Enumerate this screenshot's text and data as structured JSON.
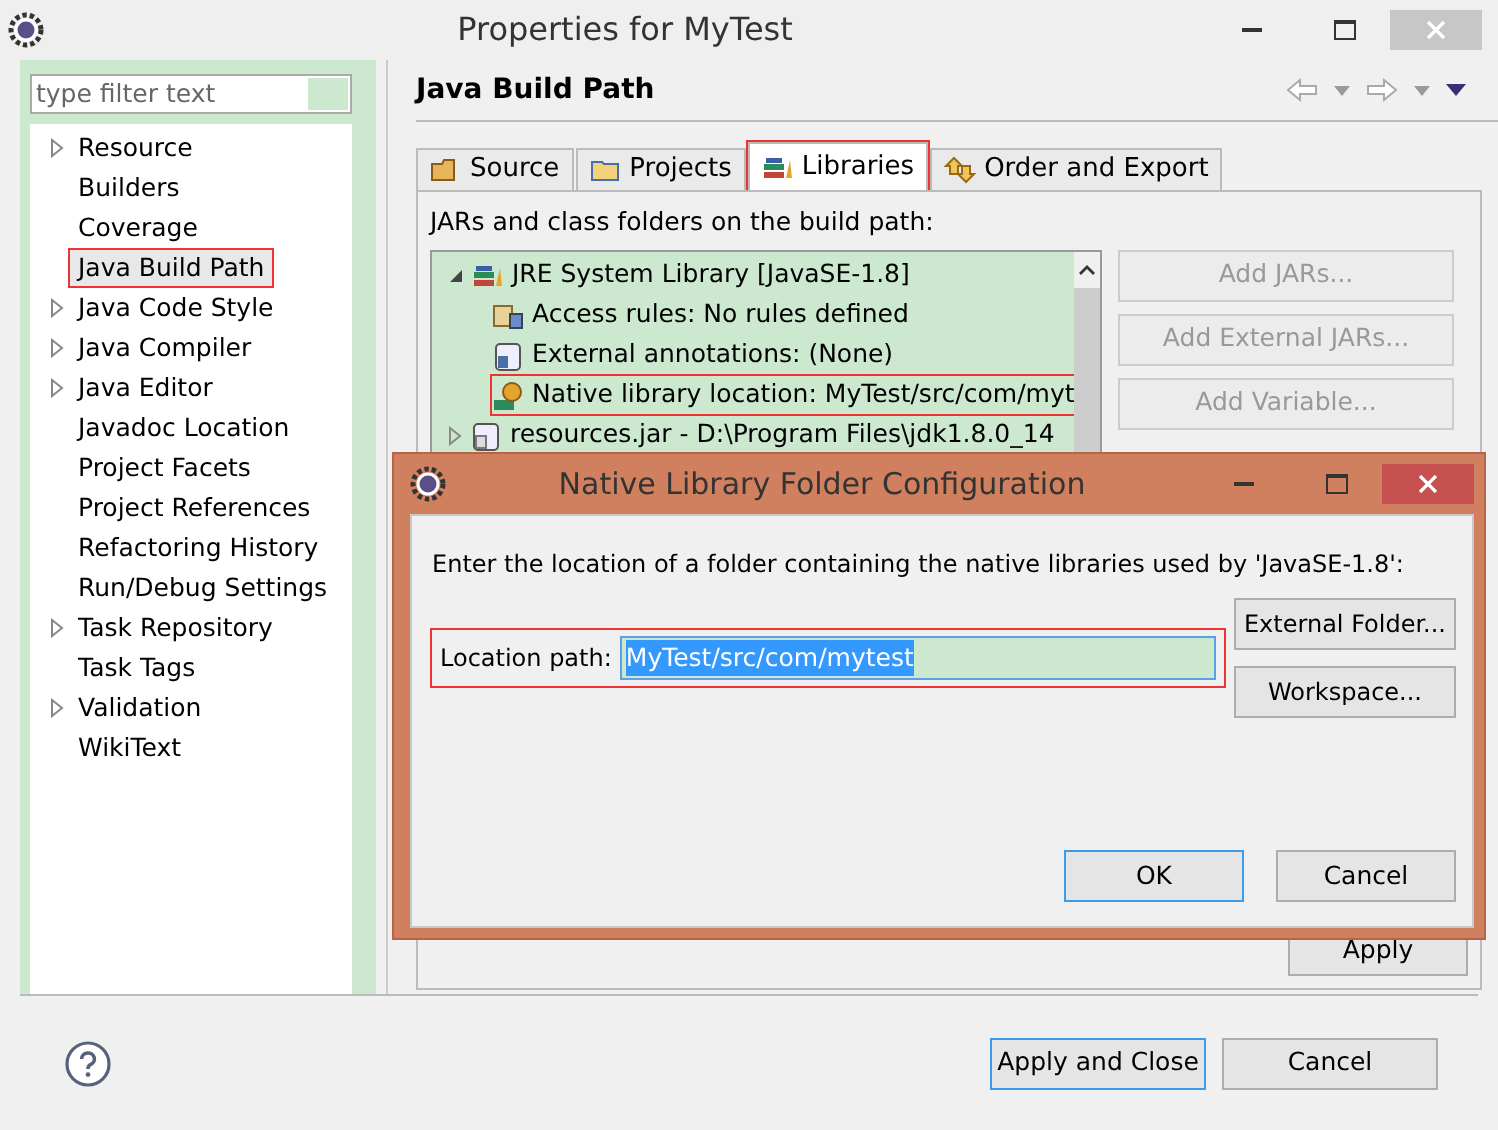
{
  "window": {
    "title": "Properties for MyTest"
  },
  "filter": {
    "placeholder": "type filter text"
  },
  "sidebar": {
    "items": [
      {
        "label": "Resource",
        "expandable": true,
        "selected": false,
        "annotated": false
      },
      {
        "label": "Builders",
        "expandable": false,
        "selected": false,
        "annotated": false
      },
      {
        "label": "Coverage",
        "expandable": false,
        "selected": false,
        "annotated": false
      },
      {
        "label": "Java Build Path",
        "expandable": false,
        "selected": true,
        "annotated": true
      },
      {
        "label": "Java Code Style",
        "expandable": true,
        "selected": false,
        "annotated": false
      },
      {
        "label": "Java Compiler",
        "expandable": true,
        "selected": false,
        "annotated": false
      },
      {
        "label": "Java Editor",
        "expandable": true,
        "selected": false,
        "annotated": false
      },
      {
        "label": "Javadoc Location",
        "expandable": false,
        "selected": false,
        "annotated": false
      },
      {
        "label": "Project Facets",
        "expandable": false,
        "selected": false,
        "annotated": false
      },
      {
        "label": "Project References",
        "expandable": false,
        "selected": false,
        "annotated": false
      },
      {
        "label": "Refactoring History",
        "expandable": false,
        "selected": false,
        "annotated": false
      },
      {
        "label": "Run/Debug Settings",
        "expandable": false,
        "selected": false,
        "annotated": false
      },
      {
        "label": "Task Repository",
        "expandable": true,
        "selected": false,
        "annotated": false
      },
      {
        "label": "Task Tags",
        "expandable": false,
        "selected": false,
        "annotated": false
      },
      {
        "label": "Validation",
        "expandable": true,
        "selected": false,
        "annotated": false
      },
      {
        "label": "WikiText",
        "expandable": false,
        "selected": false,
        "annotated": false
      }
    ]
  },
  "page": {
    "title": "Java Build Path",
    "tabs": [
      {
        "label": "Source",
        "kind": "source",
        "selected": false,
        "annotated": false
      },
      {
        "label": "Projects",
        "kind": "projects",
        "selected": false,
        "annotated": false
      },
      {
        "label": "Libraries",
        "kind": "libraries",
        "selected": true,
        "annotated": true
      },
      {
        "label": "Order and Export",
        "kind": "order",
        "selected": false,
        "annotated": false
      }
    ],
    "list_label": "JARs and class folders on the build path:",
    "tree": [
      {
        "label": "JRE System Library [JavaSE-1.8]",
        "kind": "library",
        "expanded": true,
        "annotated": false,
        "children": [
          {
            "label": "Access rules: No rules defined",
            "kind": "rules",
            "annotated": false
          },
          {
            "label": "External annotations: (None)",
            "kind": "annotations",
            "annotated": false
          },
          {
            "label": "Native library location: MyTest/src/com/myt",
            "kind": "native",
            "annotated": true
          }
        ]
      },
      {
        "label": "resources.jar - D:\\Program Files\\jdk1.8.0_14",
        "kind": "jar",
        "expanded": false,
        "annotated": false
      }
    ],
    "side_buttons": [
      {
        "label": "Add JARs...",
        "disabled": true
      },
      {
        "label": "Add External JARs...",
        "disabled": true
      },
      {
        "label": "Add Variable...",
        "disabled": true
      }
    ],
    "apply": "Apply"
  },
  "dialog": {
    "title": "Native Library Folder Configuration",
    "message": "Enter the location of a folder containing the native libraries used by 'JavaSE-1.8':",
    "location_label": "Location path:",
    "location_value": "MyTest/src/com/mytest",
    "value_selected": true,
    "annotated": true,
    "side_buttons": [
      "External Folder...",
      "Workspace..."
    ],
    "buttons": [
      {
        "label": "OK",
        "default": true
      },
      {
        "label": "Cancel",
        "default": false
      }
    ]
  },
  "footer": {
    "buttons": [
      {
        "label": "Apply and Close",
        "default": true
      },
      {
        "label": "Cancel",
        "default": false
      }
    ]
  }
}
